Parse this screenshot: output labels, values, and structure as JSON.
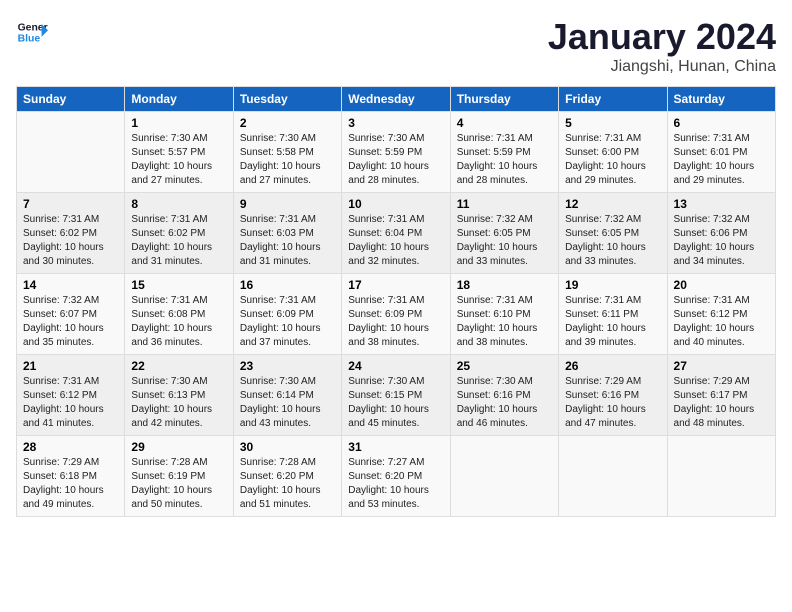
{
  "header": {
    "logo_general": "General",
    "logo_blue": "Blue",
    "month_title": "January 2024",
    "location": "Jiangshi, Hunan, China"
  },
  "weekdays": [
    "Sunday",
    "Monday",
    "Tuesday",
    "Wednesday",
    "Thursday",
    "Friday",
    "Saturday"
  ],
  "weeks": [
    [
      {
        "day": "",
        "info": ""
      },
      {
        "day": "1",
        "info": "Sunrise: 7:30 AM\nSunset: 5:57 PM\nDaylight: 10 hours\nand 27 minutes."
      },
      {
        "day": "2",
        "info": "Sunrise: 7:30 AM\nSunset: 5:58 PM\nDaylight: 10 hours\nand 27 minutes."
      },
      {
        "day": "3",
        "info": "Sunrise: 7:30 AM\nSunset: 5:59 PM\nDaylight: 10 hours\nand 28 minutes."
      },
      {
        "day": "4",
        "info": "Sunrise: 7:31 AM\nSunset: 5:59 PM\nDaylight: 10 hours\nand 28 minutes."
      },
      {
        "day": "5",
        "info": "Sunrise: 7:31 AM\nSunset: 6:00 PM\nDaylight: 10 hours\nand 29 minutes."
      },
      {
        "day": "6",
        "info": "Sunrise: 7:31 AM\nSunset: 6:01 PM\nDaylight: 10 hours\nand 29 minutes."
      }
    ],
    [
      {
        "day": "7",
        "info": "Sunrise: 7:31 AM\nSunset: 6:02 PM\nDaylight: 10 hours\nand 30 minutes."
      },
      {
        "day": "8",
        "info": "Sunrise: 7:31 AM\nSunset: 6:02 PM\nDaylight: 10 hours\nand 31 minutes."
      },
      {
        "day": "9",
        "info": "Sunrise: 7:31 AM\nSunset: 6:03 PM\nDaylight: 10 hours\nand 31 minutes."
      },
      {
        "day": "10",
        "info": "Sunrise: 7:31 AM\nSunset: 6:04 PM\nDaylight: 10 hours\nand 32 minutes."
      },
      {
        "day": "11",
        "info": "Sunrise: 7:32 AM\nSunset: 6:05 PM\nDaylight: 10 hours\nand 33 minutes."
      },
      {
        "day": "12",
        "info": "Sunrise: 7:32 AM\nSunset: 6:05 PM\nDaylight: 10 hours\nand 33 minutes."
      },
      {
        "day": "13",
        "info": "Sunrise: 7:32 AM\nSunset: 6:06 PM\nDaylight: 10 hours\nand 34 minutes."
      }
    ],
    [
      {
        "day": "14",
        "info": "Sunrise: 7:32 AM\nSunset: 6:07 PM\nDaylight: 10 hours\nand 35 minutes."
      },
      {
        "day": "15",
        "info": "Sunrise: 7:31 AM\nSunset: 6:08 PM\nDaylight: 10 hours\nand 36 minutes."
      },
      {
        "day": "16",
        "info": "Sunrise: 7:31 AM\nSunset: 6:09 PM\nDaylight: 10 hours\nand 37 minutes."
      },
      {
        "day": "17",
        "info": "Sunrise: 7:31 AM\nSunset: 6:09 PM\nDaylight: 10 hours\nand 38 minutes."
      },
      {
        "day": "18",
        "info": "Sunrise: 7:31 AM\nSunset: 6:10 PM\nDaylight: 10 hours\nand 38 minutes."
      },
      {
        "day": "19",
        "info": "Sunrise: 7:31 AM\nSunset: 6:11 PM\nDaylight: 10 hours\nand 39 minutes."
      },
      {
        "day": "20",
        "info": "Sunrise: 7:31 AM\nSunset: 6:12 PM\nDaylight: 10 hours\nand 40 minutes."
      }
    ],
    [
      {
        "day": "21",
        "info": "Sunrise: 7:31 AM\nSunset: 6:12 PM\nDaylight: 10 hours\nand 41 minutes."
      },
      {
        "day": "22",
        "info": "Sunrise: 7:30 AM\nSunset: 6:13 PM\nDaylight: 10 hours\nand 42 minutes."
      },
      {
        "day": "23",
        "info": "Sunrise: 7:30 AM\nSunset: 6:14 PM\nDaylight: 10 hours\nand 43 minutes."
      },
      {
        "day": "24",
        "info": "Sunrise: 7:30 AM\nSunset: 6:15 PM\nDaylight: 10 hours\nand 45 minutes."
      },
      {
        "day": "25",
        "info": "Sunrise: 7:30 AM\nSunset: 6:16 PM\nDaylight: 10 hours\nand 46 minutes."
      },
      {
        "day": "26",
        "info": "Sunrise: 7:29 AM\nSunset: 6:16 PM\nDaylight: 10 hours\nand 47 minutes."
      },
      {
        "day": "27",
        "info": "Sunrise: 7:29 AM\nSunset: 6:17 PM\nDaylight: 10 hours\nand 48 minutes."
      }
    ],
    [
      {
        "day": "28",
        "info": "Sunrise: 7:29 AM\nSunset: 6:18 PM\nDaylight: 10 hours\nand 49 minutes."
      },
      {
        "day": "29",
        "info": "Sunrise: 7:28 AM\nSunset: 6:19 PM\nDaylight: 10 hours\nand 50 minutes."
      },
      {
        "day": "30",
        "info": "Sunrise: 7:28 AM\nSunset: 6:20 PM\nDaylight: 10 hours\nand 51 minutes."
      },
      {
        "day": "31",
        "info": "Sunrise: 7:27 AM\nSunset: 6:20 PM\nDaylight: 10 hours\nand 53 minutes."
      },
      {
        "day": "",
        "info": ""
      },
      {
        "day": "",
        "info": ""
      },
      {
        "day": "",
        "info": ""
      }
    ]
  ]
}
